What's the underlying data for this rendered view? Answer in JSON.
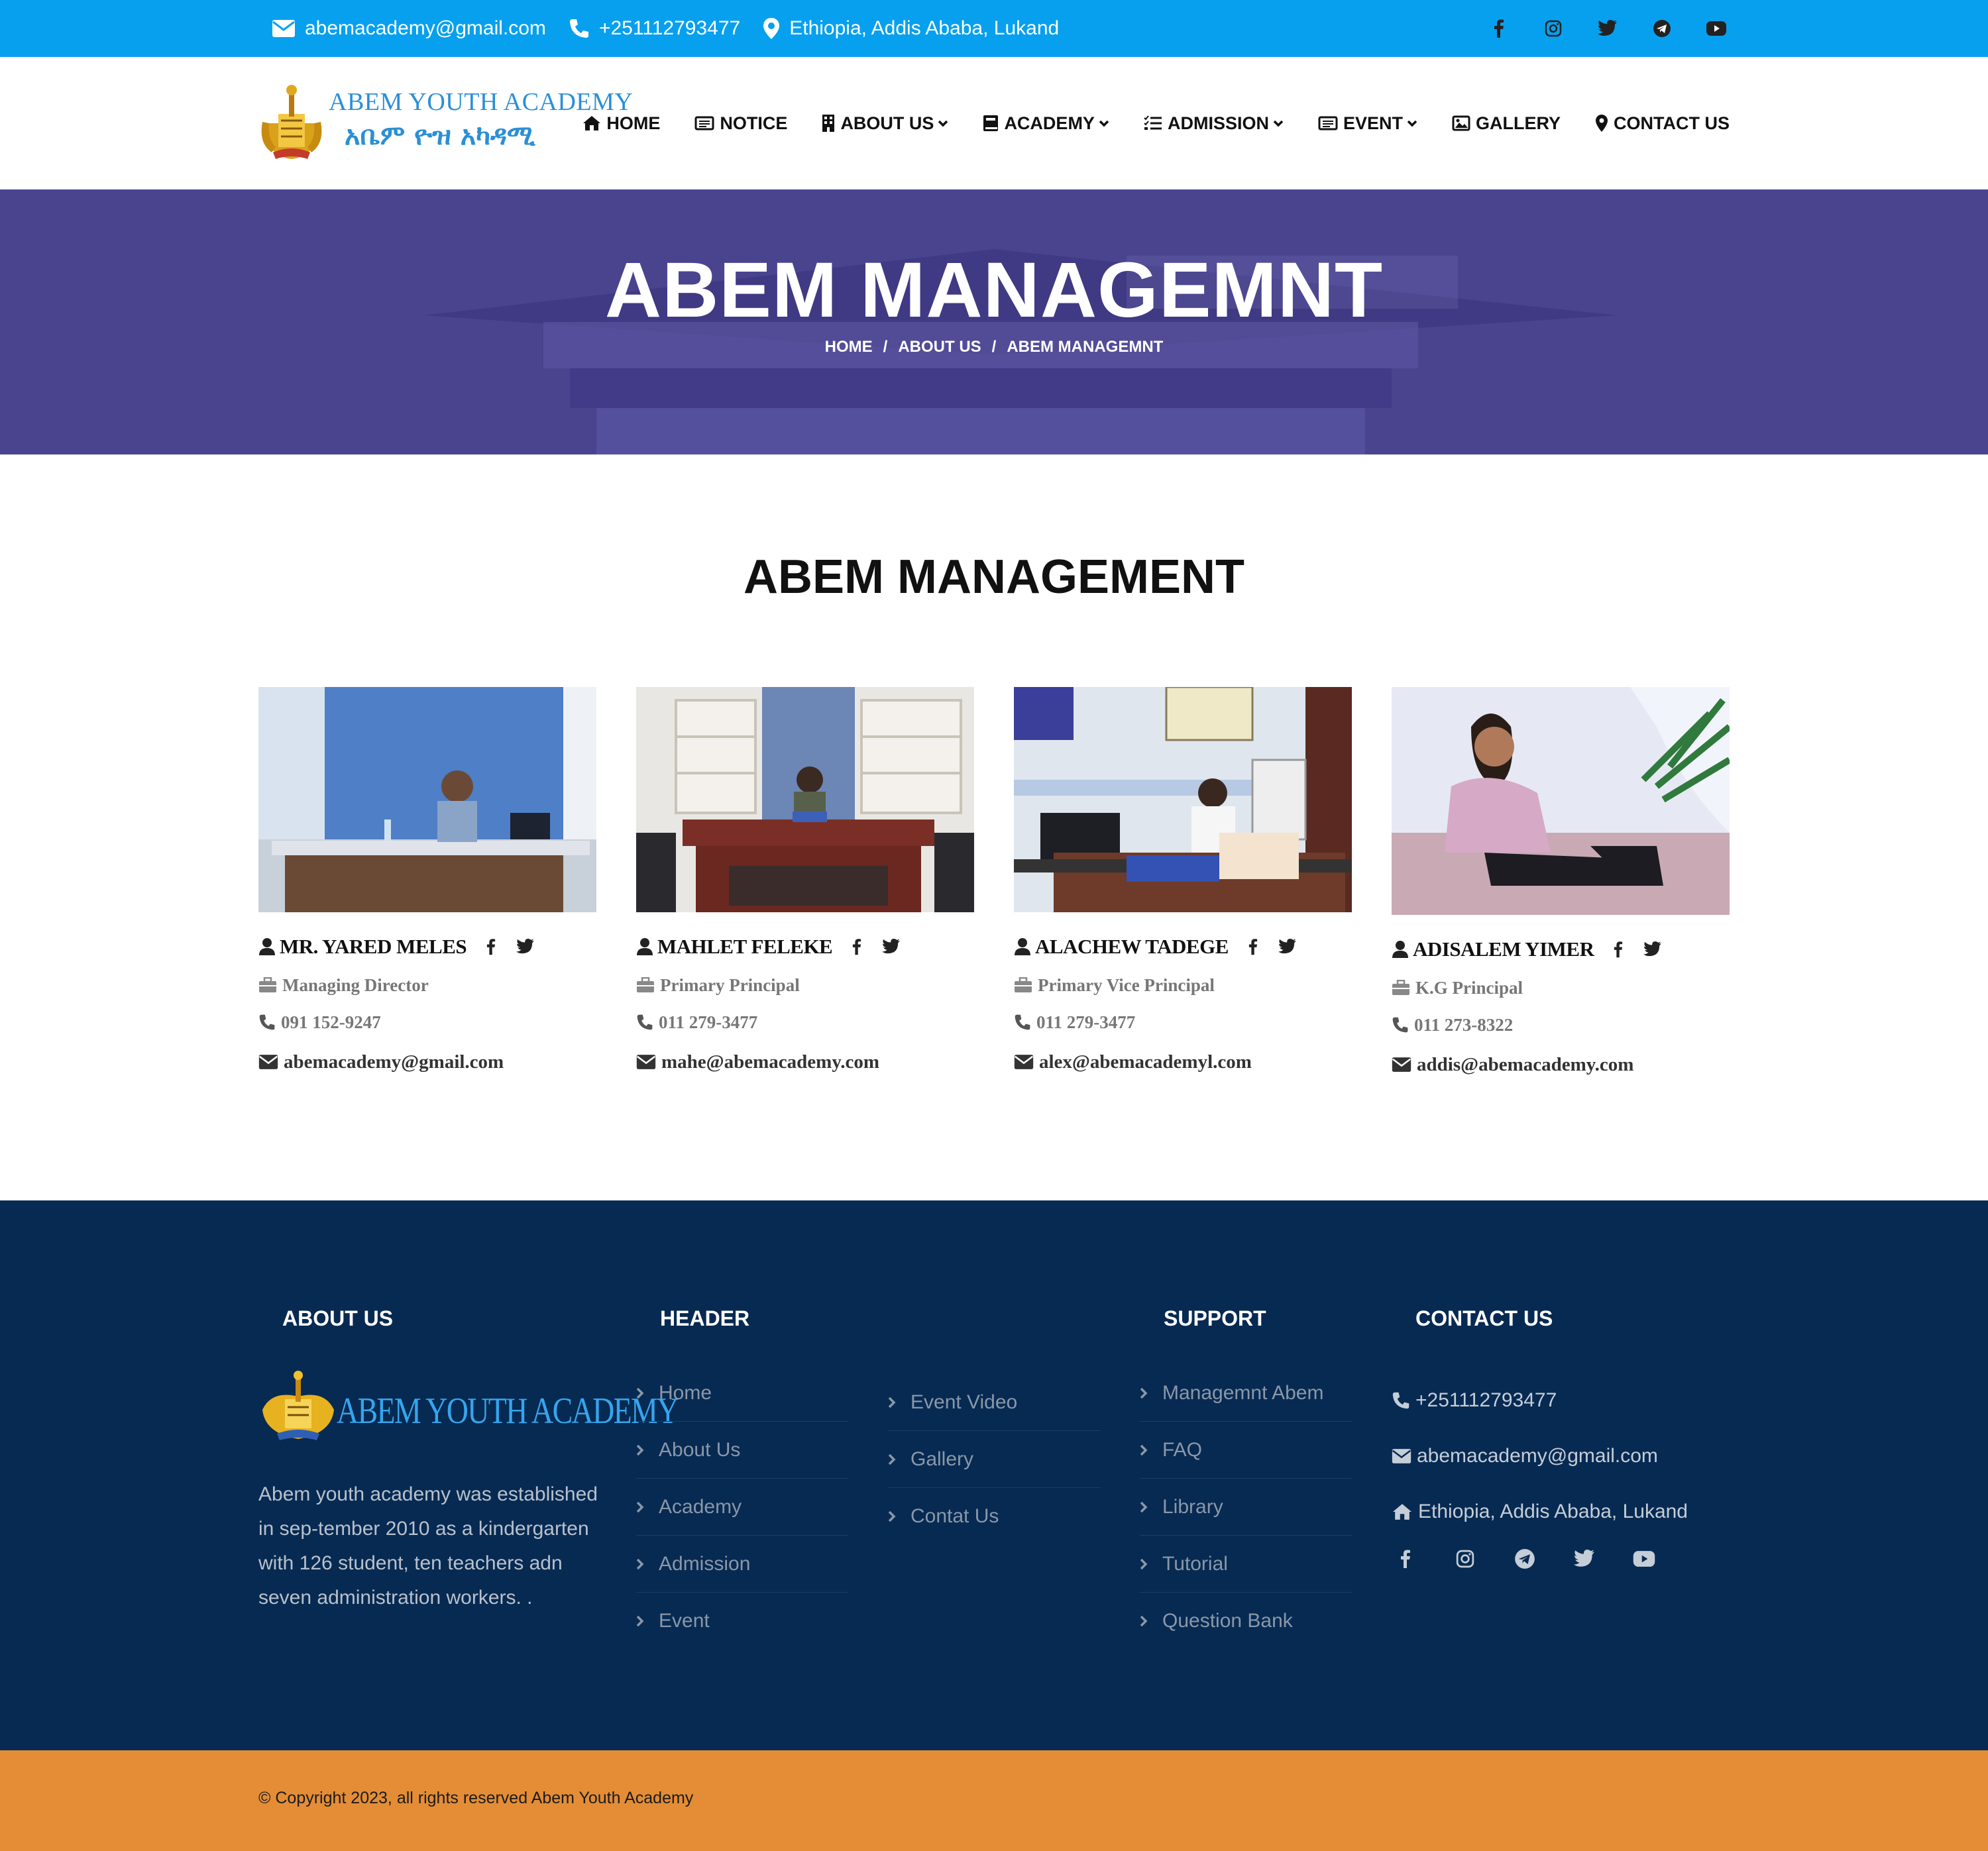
{
  "topbar": {
    "email": "abemacademy@gmail.com",
    "phone": "+251112793477",
    "address": "Ethiopia, Addis Ababa, Lukand",
    "social_icons": [
      "facebook-icon",
      "instagram-icon",
      "twitter-icon",
      "telegram-icon",
      "youtube-icon"
    ],
    "bg_color": "#07a0ee"
  },
  "logo": {
    "name_en": "ABEM YOUTH ACADEMY",
    "name_am": "አቤም ዮዝ አካዳሚ"
  },
  "nav": {
    "home": "HOME",
    "notice": "NOTICE",
    "about": "ABOUT US",
    "academy": "ACADEMY",
    "admission": "ADMISSION",
    "event": "EVENT",
    "gallery": "GALLERY",
    "contact": "CONTACT US"
  },
  "hero": {
    "title": "ABEM MANAGEMNT",
    "crumbs": [
      "HOME",
      "ABOUT US",
      "ABEM MANAGEMNT"
    ],
    "sep": "/"
  },
  "section": {
    "title": "ABEM MANAGEMENT"
  },
  "staff": [
    {
      "name": "MR. YARED MELES",
      "role": "Managing Director",
      "phone": "091 152-9247",
      "email": "abemacademy@gmail.com"
    },
    {
      "name": "MAHLET FELEKE",
      "role": "Primary Principal",
      "phone": "011 279-3477",
      "email": "mahe@abemacademy.com"
    },
    {
      "name": "ALACHEW TADEGE",
      "role": "Primary Vice Principal",
      "phone": "011 279-3477",
      "email": "alex@abemacademyl.com"
    },
    {
      "name": "ADISALEM YIMER",
      "role": "K.G Principal",
      "phone": "011 273-8322",
      "email": "addis@abemacademy.com"
    }
  ],
  "footer": {
    "about_heading": "ABOUT US",
    "header_heading": "HEADER",
    "support_heading": "SUPPORT",
    "contact_heading": "CONTACT US",
    "logo_text": "ABEM YOUTH ACADEMY",
    "about_text": "Abem youth academy was established in sep-tember 2010 as a kindergarten with 126 student, ten teachers adn seven administration workers. .",
    "header_links_1": [
      "Home",
      "About Us",
      "Academy",
      "Admission",
      "Event"
    ],
    "header_links_2": [
      "Event Video",
      "Gallery",
      "Contat Us"
    ],
    "support_links": [
      "Managemnt Abem",
      "FAQ",
      "Library",
      "Tutorial",
      "Question Bank"
    ],
    "phone": "+251112793477",
    "email": "abemacademy@gmail.com",
    "address": "Ethiopia, Addis Ababa, Lukand",
    "social_icons": [
      "facebook-icon",
      "instagram-icon",
      "telegram-icon",
      "twitter-icon",
      "youtube-icon"
    ],
    "bg_color": "#072a52"
  },
  "copyright": {
    "text": "© Copyright 2023, all rights reserved Abem Youth Academy",
    "bg_color": "#e48d36"
  }
}
